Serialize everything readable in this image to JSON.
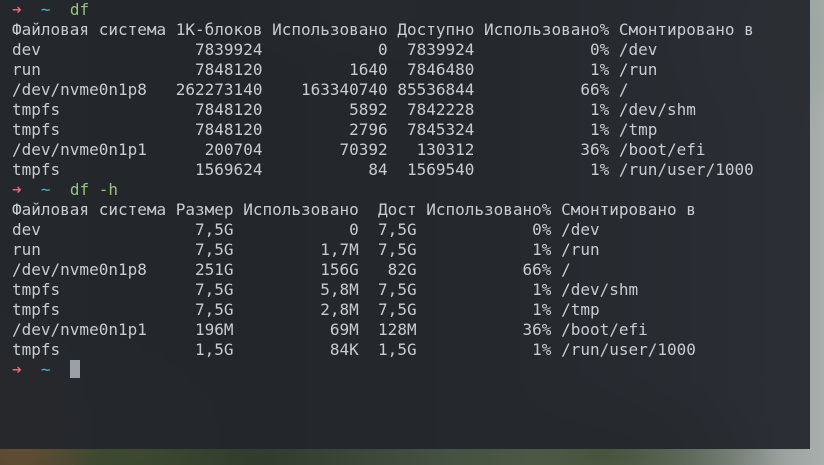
{
  "prompt": {
    "arrow": "➜",
    "cwd": "~"
  },
  "commands": [
    {
      "command": "df",
      "header": "Файловая система 1К-блоков Использовано Доступно Использовано% Смонтировано в",
      "rows": [
        "dev                7839924            0  7839924            0% /dev",
        "run                7848120         1640  7846480            1% /run",
        "/dev/nvme0n1p8   262273140    163340740 85536844           66% /",
        "tmpfs              7848120         5892  7842228            1% /dev/shm",
        "tmpfs              7848120         2796  7845324            1% /tmp",
        "/dev/nvme0n1p1      200704        70392   130312           36% /boot/efi",
        "tmpfs              1569624           84  1569540            1% /run/user/1000"
      ]
    },
    {
      "command": "df -h",
      "header": "Файловая система Размер Использовано  Дост Использовано% Смонтировано в",
      "rows": [
        "dev                7,5G            0  7,5G            0% /dev",
        "run                7,5G         1,7M  7,5G            1% /run",
        "/dev/nvme0n1p8     251G         156G   82G           66% /",
        "tmpfs              7,5G         5,8M  7,5G            1% /dev/shm",
        "tmpfs              7,5G         2,8M  7,5G            1% /tmp",
        "/dev/nvme0n1p1     196M          69M  128M           36% /boot/efi",
        "tmpfs              1,5G          84K  1,5G            1% /run/user/1000"
      ]
    }
  ]
}
